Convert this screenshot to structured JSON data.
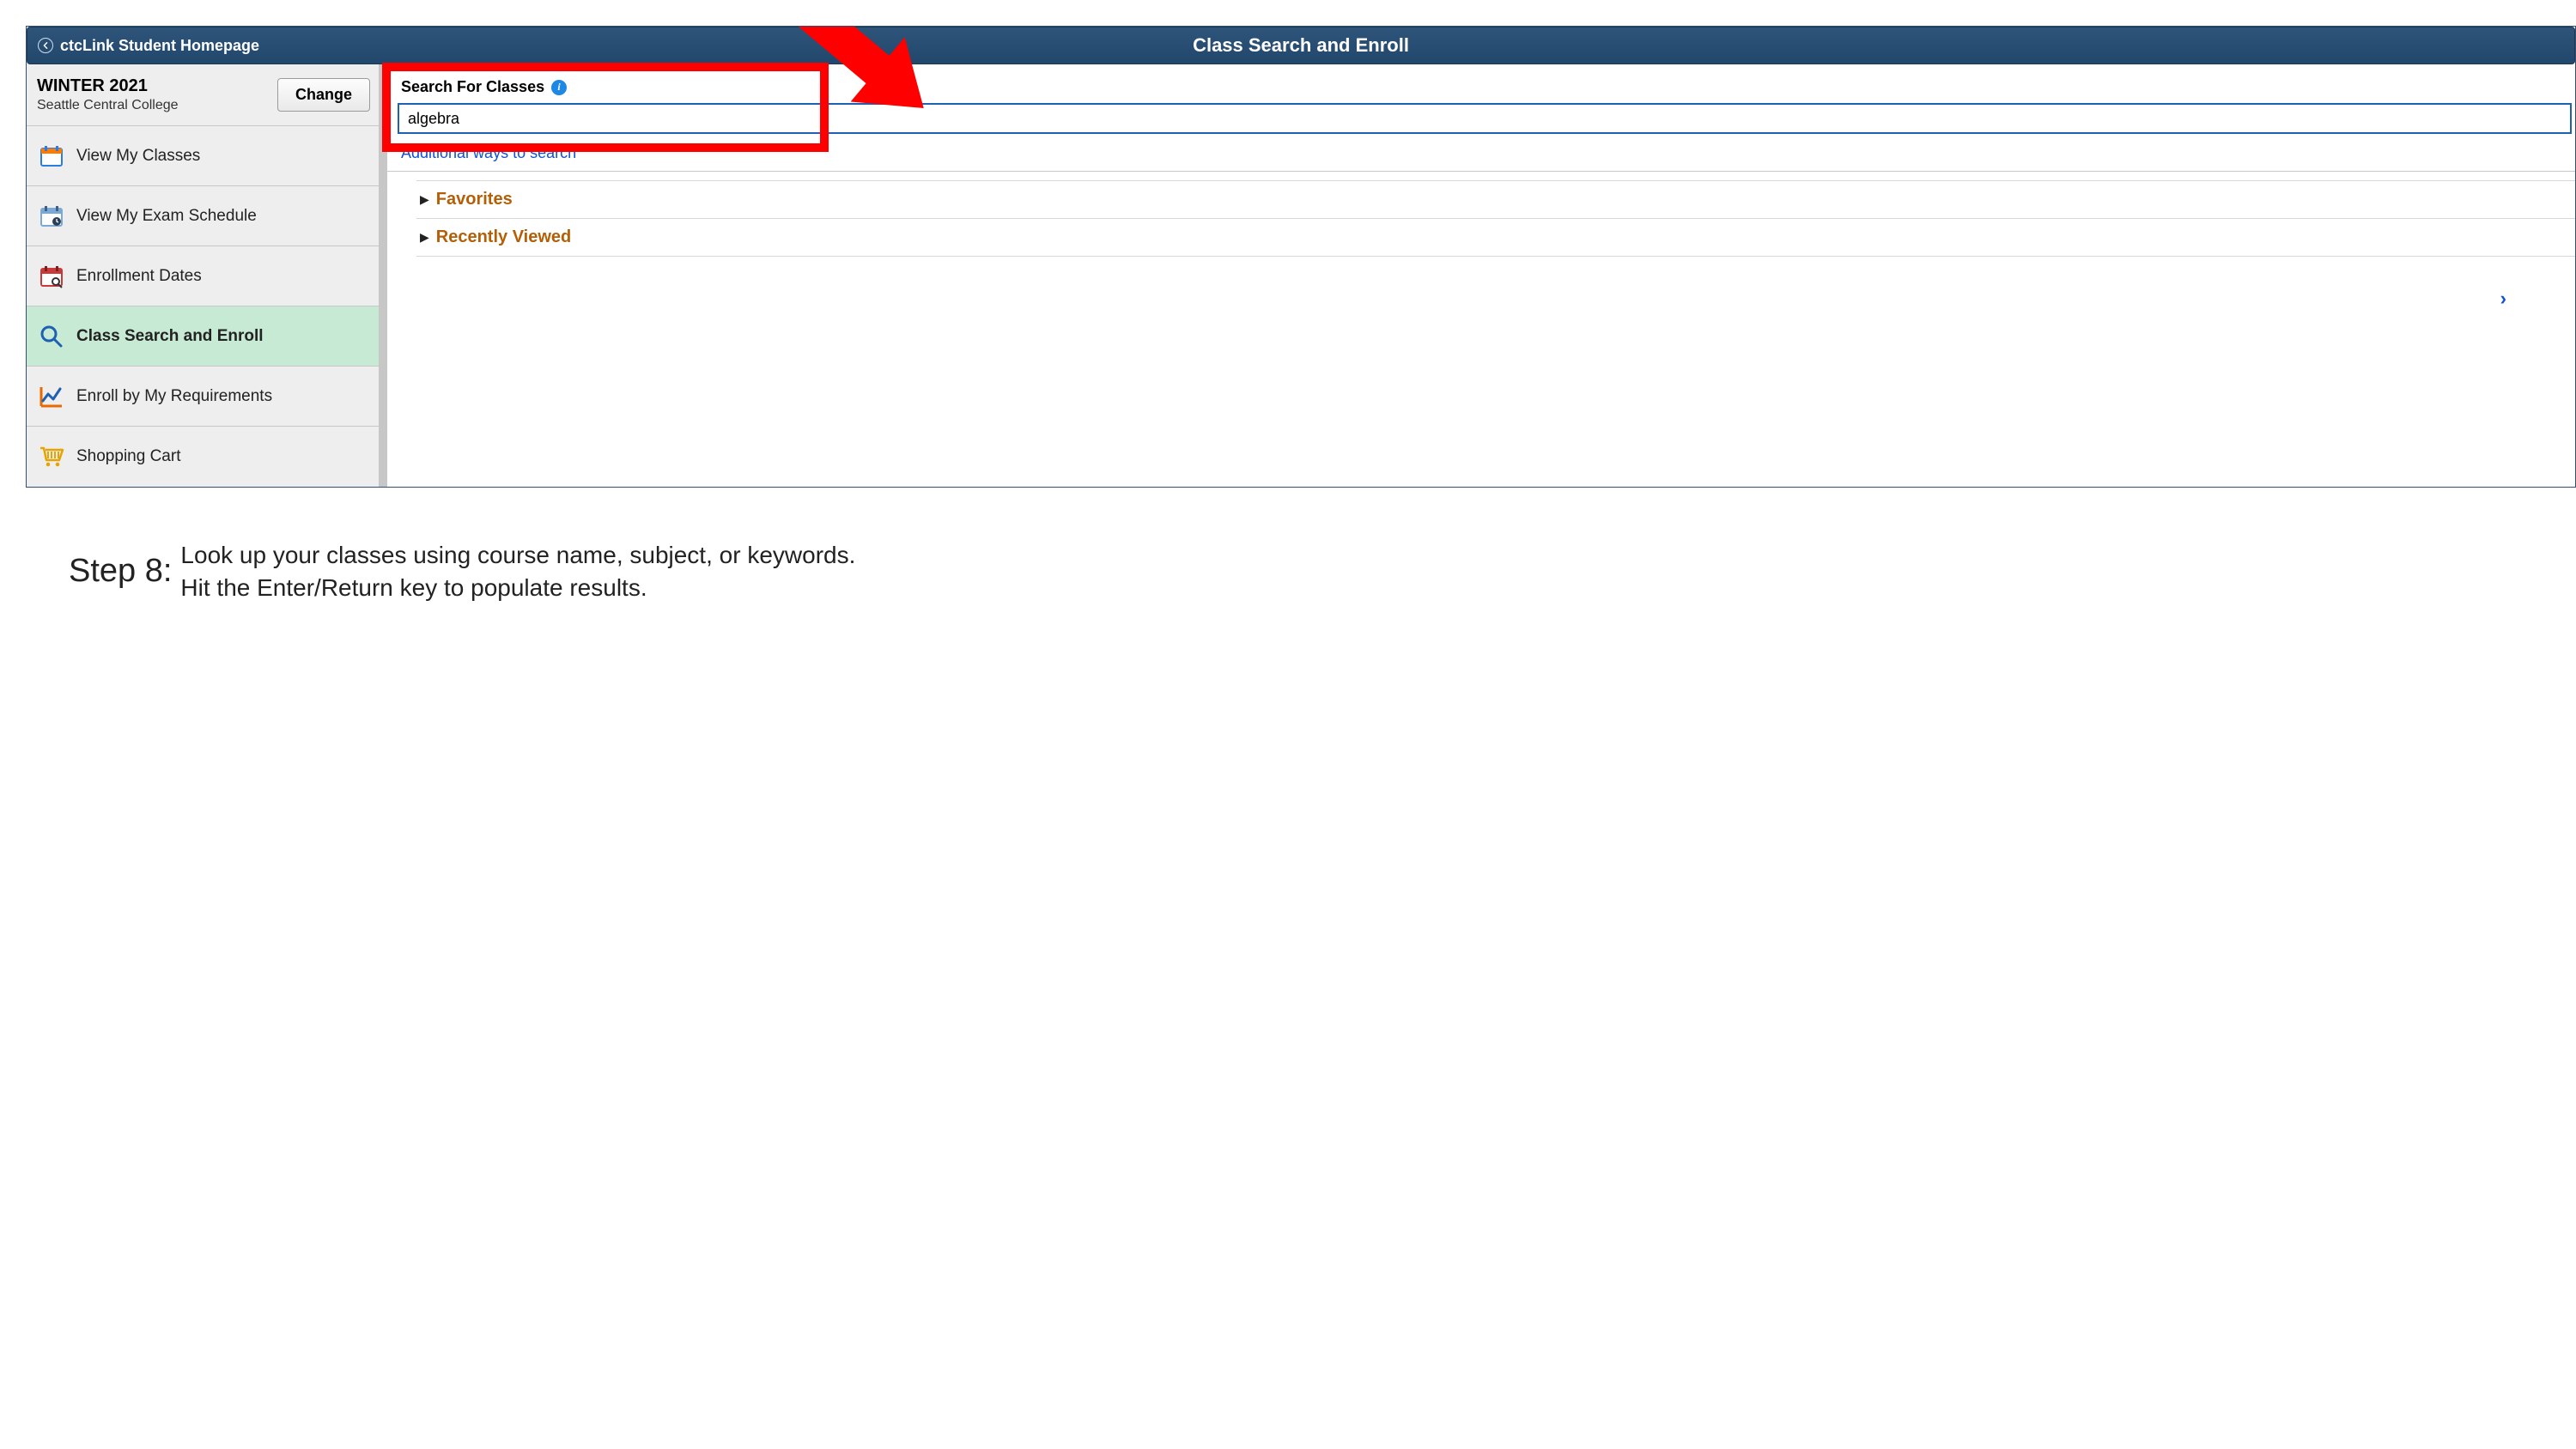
{
  "header": {
    "back_label": "ctcLink Student Homepage",
    "title": "Class Search and Enroll"
  },
  "term_block": {
    "term": "WINTER 2021",
    "college": "Seattle Central College",
    "change_label": "Change"
  },
  "sidebar": {
    "items": [
      {
        "label": "View My Classes"
      },
      {
        "label": "View My Exam Schedule"
      },
      {
        "label": "Enrollment Dates"
      },
      {
        "label": "Class Search and Enroll"
      },
      {
        "label": "Enroll by My Requirements"
      },
      {
        "label": "Shopping Cart"
      }
    ]
  },
  "search": {
    "label": "Search For Classes",
    "value": "algebra",
    "additional_link": "Additional ways to search"
  },
  "collapsibles": {
    "favorites": "Favorites",
    "recent": "Recently Viewed"
  },
  "caption": {
    "step": "Step 8:",
    "text_line1": "Look up your classes using course name, subject, or keywords.",
    "text_line2": "Hit the Enter/Return key to populate results."
  }
}
